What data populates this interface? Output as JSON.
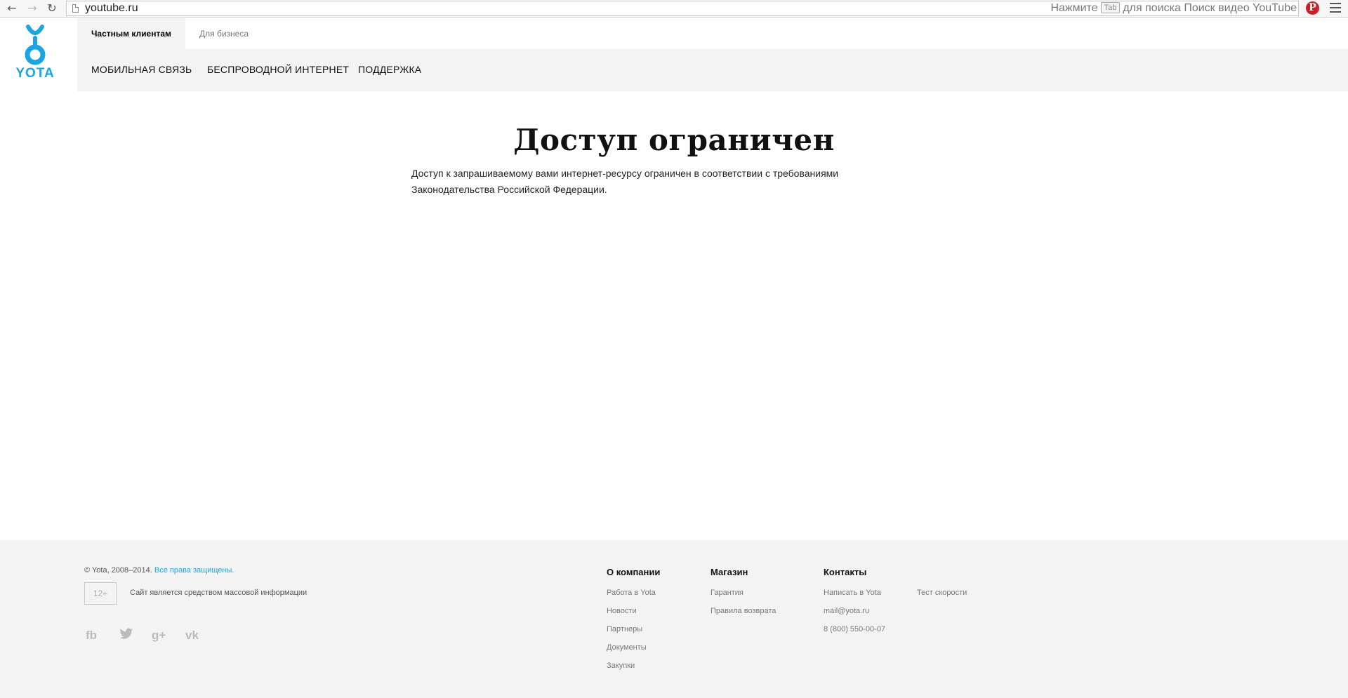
{
  "browser": {
    "url": "youtube.ru",
    "hint_before": "Нажмите",
    "hint_key": "Tab",
    "hint_after": "для поиска Поиск видео YouTube"
  },
  "header": {
    "logo_text": "YOTA",
    "brand_color": "#1aa6e4",
    "segments": [
      "Частным клиентам",
      "Для бизнеса"
    ],
    "nav": [
      "МОБИЛЬНАЯ СВЯЗЬ",
      "БЕСПРОВОДНОЙ ИНТЕРНЕТ",
      "ПОДДЕРЖКА"
    ]
  },
  "main": {
    "title": "Доступ ограничен",
    "text": "Доступ к запрашиваемому вами интернет-ресурсу ограничен в соответствии с требованиями Законодательства Российской Федерации."
  },
  "footer": {
    "copyright": "© Yota, 2008–2014.",
    "rights_link": "Все права защищены.",
    "age": "12+",
    "media_note": "Сайт является средством массовой информации",
    "social": {
      "fb": "fb",
      "gplus": "g+",
      "vk": "vk"
    },
    "columns": [
      {
        "title": "О компании",
        "links": [
          "Работа в Yota",
          "Новости",
          "Партнеры",
          "Документы",
          "Закупки"
        ]
      },
      {
        "title": "Магазин",
        "links": [
          "Гарантия",
          "Правила возврата"
        ]
      },
      {
        "title": "Контакты",
        "links": [
          "Написать в Yota",
          "mail@yota.ru",
          "8 (800) 550-00-07"
        ]
      },
      {
        "title": "",
        "links": [
          "Тест скорости"
        ]
      }
    ]
  }
}
